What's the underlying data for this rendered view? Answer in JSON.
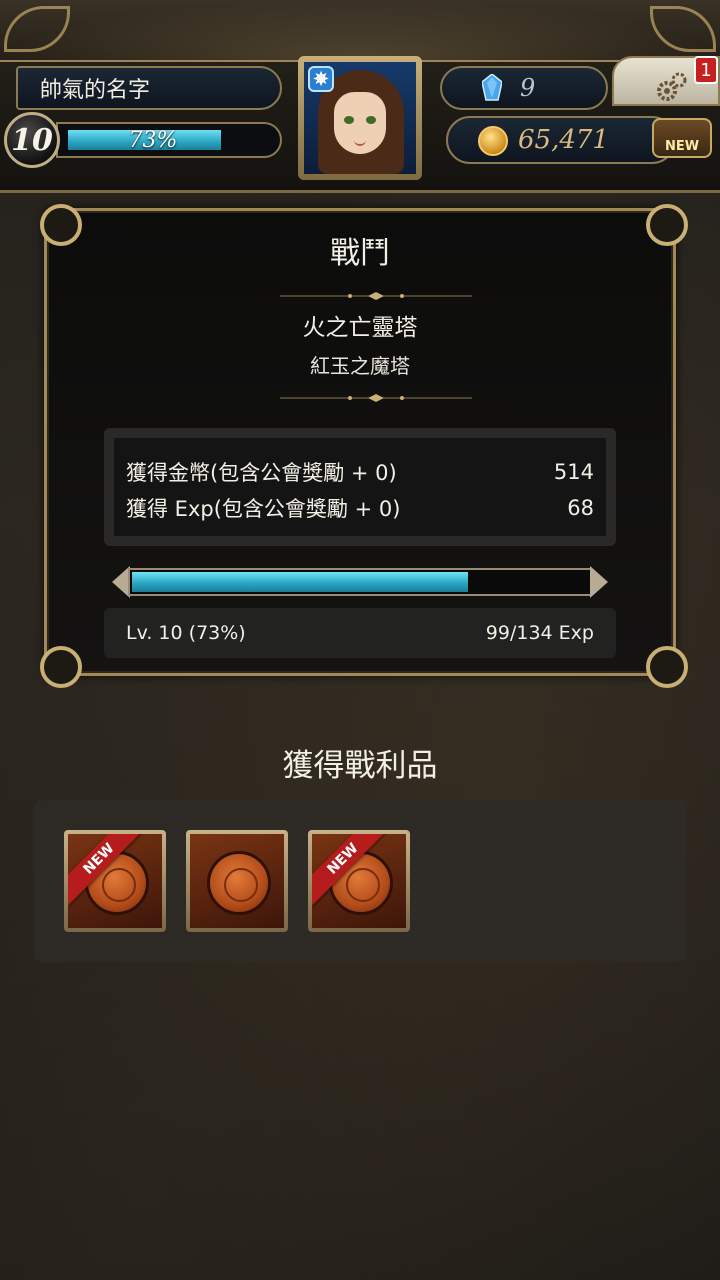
{
  "player": {
    "name": "帥氣的名字",
    "level": "10",
    "exp_percent_label": "73%",
    "exp_fraction": 0.73
  },
  "currency": {
    "gems": "9",
    "gold": "65,471"
  },
  "notifications": {
    "settings_badge": "1",
    "new_label": "NEW"
  },
  "battle": {
    "title": "戰鬥",
    "stage": "火之亡靈塔",
    "substage": "紅玉之魔塔",
    "rewards": [
      {
        "label": "獲得金幣(包含公會獎勵 + 0)",
        "value": "514"
      },
      {
        "label": "獲得 Exp(包含公會獎勵 + 0)",
        "value": "68"
      }
    ],
    "progress_fraction": 0.73,
    "level_text": "Lv. 10 (73%)",
    "exp_text": "99/134 Exp"
  },
  "loot": {
    "title": "獲得戰利品",
    "items": [
      {
        "new": true,
        "badge": "NEW"
      },
      {
        "new": false,
        "badge": ""
      },
      {
        "new": true,
        "badge": "NEW"
      }
    ]
  },
  "colors": {
    "exp_bar": "#29a7c4",
    "panel_border": "#a3885a",
    "new_ribbon": "#b51c1c"
  }
}
